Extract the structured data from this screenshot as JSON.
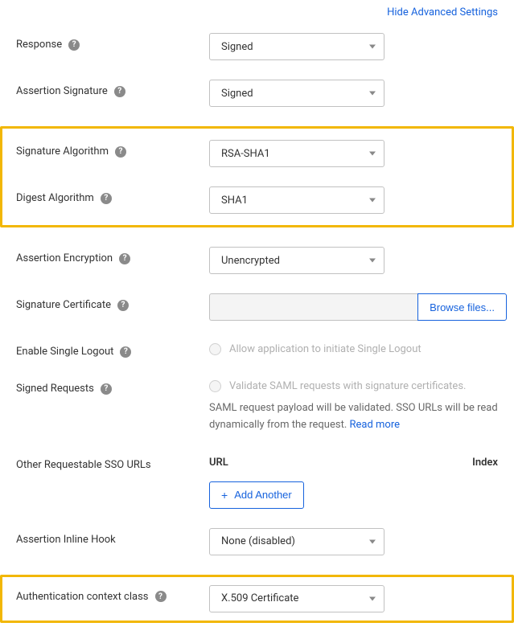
{
  "topLink": "Hide Advanced Settings",
  "fields": {
    "response": {
      "label": "Response",
      "value": "Signed"
    },
    "assertionSignature": {
      "label": "Assertion Signature",
      "value": "Signed"
    },
    "signatureAlgorithm": {
      "label": "Signature Algorithm",
      "value": "RSA-SHA1"
    },
    "digestAlgorithm": {
      "label": "Digest Algorithm",
      "value": "SHA1"
    },
    "assertionEncryption": {
      "label": "Assertion Encryption",
      "value": "Unencrypted"
    },
    "signatureCertificate": {
      "label": "Signature Certificate",
      "browse": "Browse files..."
    },
    "enableSingleLogout": {
      "label": "Enable Single Logout",
      "checkboxLabel": "Allow application to initiate Single Logout"
    },
    "signedRequests": {
      "label": "Signed Requests",
      "checkboxLabel": "Validate SAML requests with signature certificates.",
      "helper": "SAML request payload will be validated. SSO URLs will be read dynamically from the request. ",
      "readMore": "Read more"
    },
    "otherSSO": {
      "label": "Other Requestable SSO URLs",
      "colUrl": "URL",
      "colIndex": "Index",
      "addAnother": "Add Another"
    },
    "assertionInlineHook": {
      "label": "Assertion Inline Hook",
      "value": "None (disabled)"
    },
    "authContext": {
      "label": "Authentication context class",
      "value": "X.509 Certificate"
    }
  }
}
